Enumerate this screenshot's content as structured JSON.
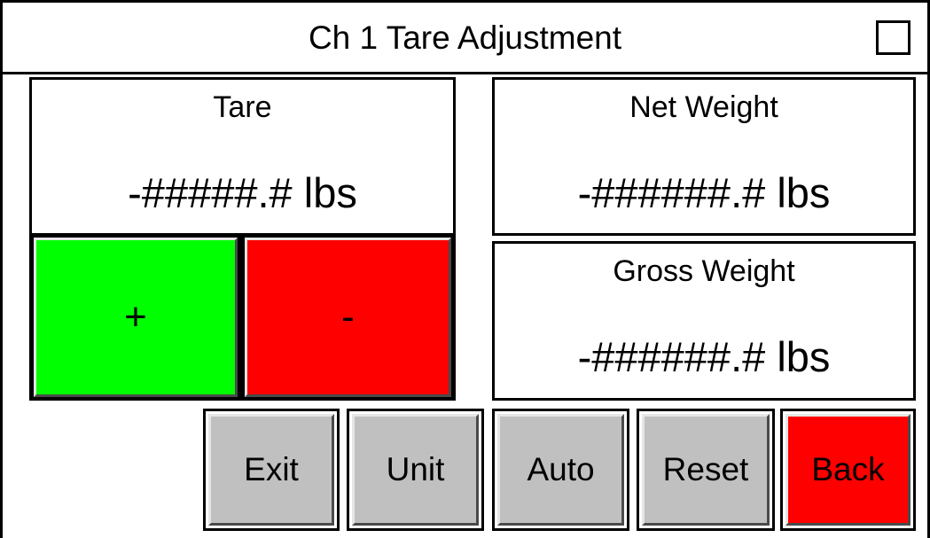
{
  "header": {
    "title": "Ch 1 Tare Adjustment",
    "checkbox_checked": false
  },
  "tare": {
    "label": "Tare",
    "value": "-#####.# lbs"
  },
  "net_weight": {
    "label": "Net Weight",
    "value": "-######.# lbs"
  },
  "gross_weight": {
    "label": "Gross Weight",
    "value": "-######.# lbs"
  },
  "adjust": {
    "plus_label": "+",
    "minus_label": "-",
    "plus_color": "#00ff00",
    "minus_color": "#ff0000"
  },
  "buttons": {
    "exit_label": "Exit",
    "unit_label": "Unit",
    "auto_label": "Auto",
    "reset_label": "Reset",
    "back_label": "Back",
    "default_color": "#c0c0c0",
    "back_color": "#ff0000"
  }
}
